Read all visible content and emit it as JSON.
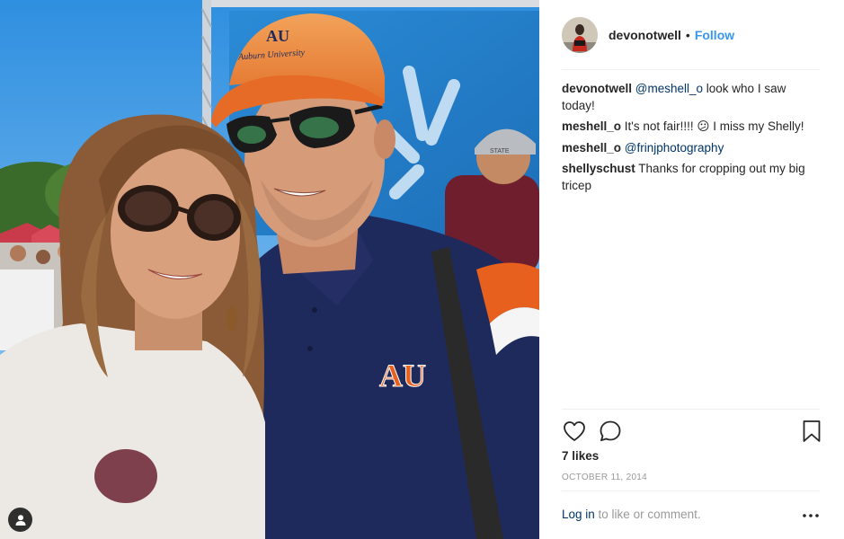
{
  "post": {
    "username": "devonotwell",
    "dot": "•",
    "follow_label": "Follow"
  },
  "photo": {
    "cap_logo": "AU",
    "cap_text": "Auburn University",
    "shirt_logo": "AU",
    "bg_hat_text": "STATE"
  },
  "comments": [
    {
      "user": "devonotwell",
      "mention": "@meshell_o",
      "text": " look who I saw today!"
    },
    {
      "user": "meshell_o",
      "mention": "",
      "text": " It's not fair!!!! 😕 I miss my Shelly!"
    },
    {
      "user": "meshell_o",
      "mention": "@frinjphotography",
      "text": ""
    },
    {
      "user": "shellyschust",
      "mention": "",
      "text": " Thanks for cropping out my big tricep"
    }
  ],
  "likes": "7 likes",
  "date": "October 11, 2014",
  "footer": {
    "login_label": "Log in",
    "rest": " to like or comment."
  },
  "icons": {
    "like": "heart-icon",
    "comment": "speech-bubble-icon",
    "save": "bookmark-icon",
    "more": "more-dots-icon",
    "tag": "user-tag-icon"
  },
  "colors": {
    "follow": "#3897f0",
    "link": "#003569",
    "muted": "#999999",
    "auburn_orange": "#e8601d",
    "auburn_navy": "#1f2a5c"
  }
}
